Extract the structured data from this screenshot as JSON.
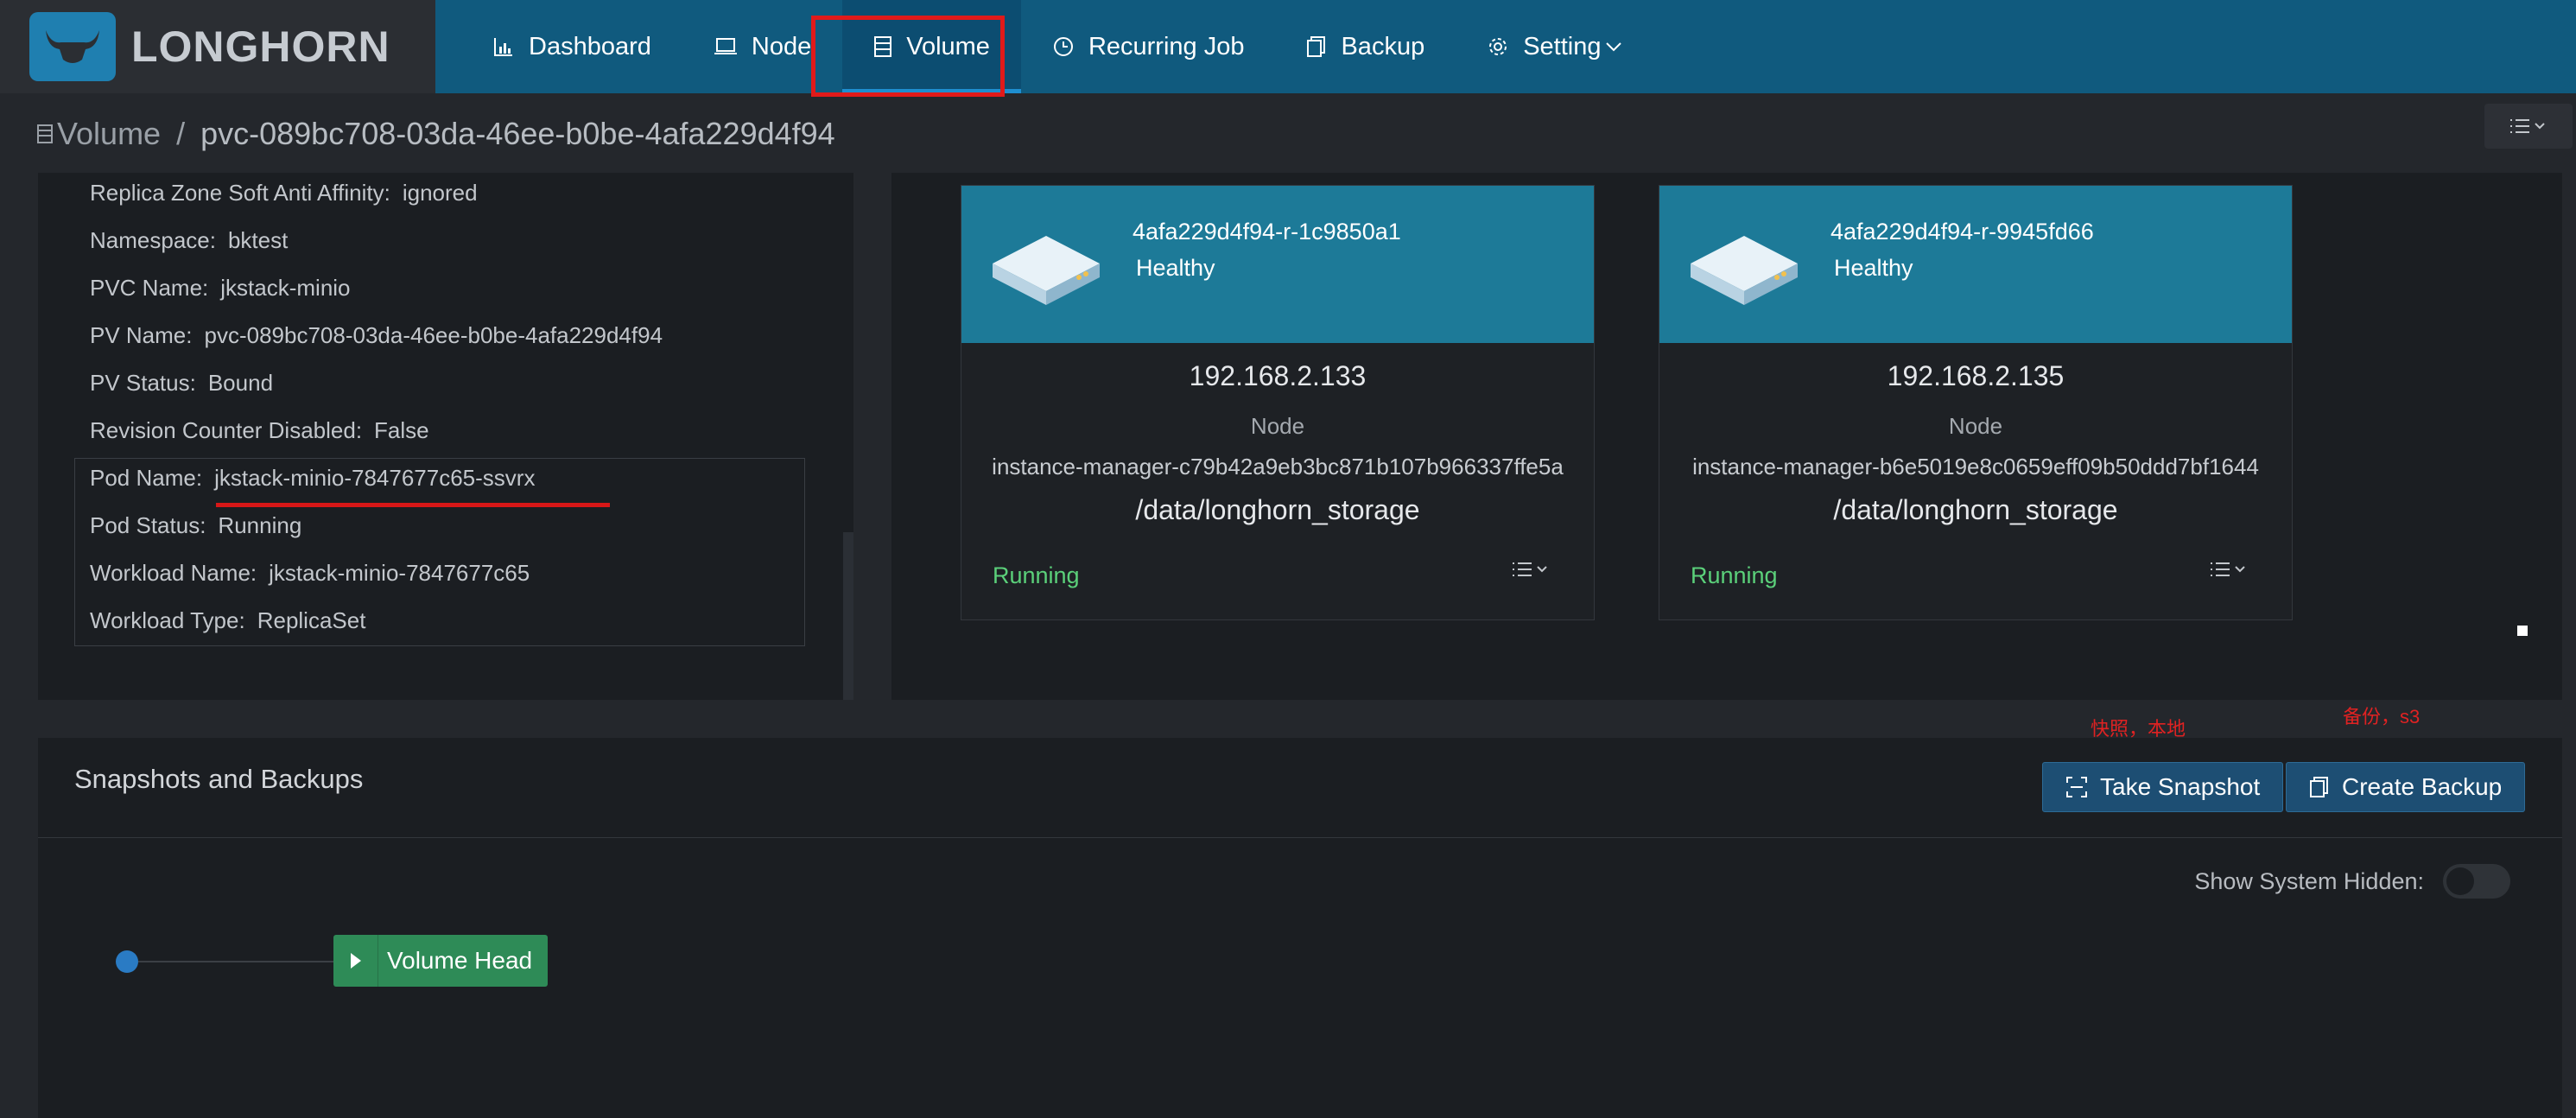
{
  "brand": {
    "name": "LONGHORN"
  },
  "nav": {
    "items": [
      {
        "label": "Dashboard",
        "icon": "bar-chart-icon"
      },
      {
        "label": "Node",
        "icon": "laptop-icon"
      },
      {
        "label": "Volume",
        "icon": "database-icon",
        "active": true
      },
      {
        "label": "Recurring Job",
        "icon": "clock-icon"
      },
      {
        "label": "Backup",
        "icon": "copy-icon"
      },
      {
        "label": "Setting",
        "icon": "gear-icon"
      }
    ]
  },
  "breadcrumb": {
    "root": "Volume",
    "separator": "/",
    "current": "pvc-089bc708-03da-46ee-b0be-4afa229d4f94"
  },
  "details": {
    "rows": [
      {
        "label": "Replica Zone Soft Anti Affinity:",
        "value": "ignored"
      },
      {
        "label": "Namespace:",
        "value": "bktest"
      },
      {
        "label": "PVC Name:",
        "value": "jkstack-minio"
      },
      {
        "label": "PV Name:",
        "value": "pvc-089bc708-03da-46ee-b0be-4afa229d4f94"
      },
      {
        "label": "PV Status:",
        "value": "Bound"
      },
      {
        "label": "Revision Counter Disabled:",
        "value": "False"
      },
      {
        "label": "Pod Name:",
        "value": "jkstack-minio-7847677c65-ssvrx"
      },
      {
        "label": "Pod Status:",
        "value": "Running"
      },
      {
        "label": "Workload Name:",
        "value": "jkstack-minio-7847677c65"
      },
      {
        "label": "Workload Type:",
        "value": "ReplicaSet"
      }
    ]
  },
  "replicas": [
    {
      "name": "4afa229d4f94-r-1c9850a1",
      "health": "Healthy",
      "ip": "192.168.2.133",
      "node_label": "Node",
      "instance": "instance-manager-c79b42a9eb3bc871b107b966337ffe5a",
      "path": "/data/longhorn_storage",
      "status": "Running"
    },
    {
      "name": "4afa229d4f94-r-9945fd66",
      "health": "Healthy",
      "ip": "192.168.2.135",
      "node_label": "Node",
      "instance": "instance-manager-b6e5019e8c0659eff09b50ddd7bf1644",
      "path": "/data/longhorn_storage",
      "status": "Running"
    }
  ],
  "annotations": {
    "snapshot_note": "快照，本地",
    "backup_note": "备份，s3"
  },
  "snapshots": {
    "title": "Snapshots and Backups",
    "take_snapshot_label": "Take Snapshot",
    "create_backup_label": "Create Backup",
    "show_hidden_label": "Show System Hidden:",
    "show_hidden_value": false,
    "volume_head_label": "Volume Head"
  },
  "colors": {
    "nav_bg": "#105a7e",
    "replica_header": "#1d7a98",
    "running": "#5bd07a",
    "volume_head": "#2e8b57",
    "annotation": "#e02222"
  }
}
